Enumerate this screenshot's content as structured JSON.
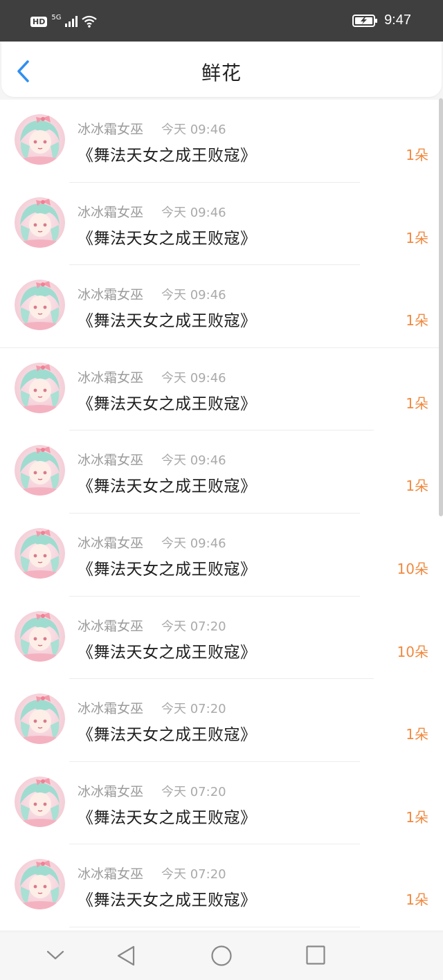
{
  "status_bar": {
    "hd": "HD",
    "network": "5G",
    "time": "9:47"
  },
  "header": {
    "title": "鲜花",
    "back_icon": "chevron-left-icon"
  },
  "colors": {
    "accent_blue": "#2f8ff0",
    "amount_orange": "#f0893f"
  },
  "items": [
    {
      "name": "冰冰霜女巫",
      "time": "今天 09:46",
      "work": "《舞法天女之成王败寇》",
      "amount": "1朵"
    },
    {
      "name": "冰冰霜女巫",
      "time": "今天 09:46",
      "work": "《舞法天女之成王败寇》",
      "amount": "1朵"
    },
    {
      "name": "冰冰霜女巫",
      "time": "今天 09:46",
      "work": "《舞法天女之成王败寇》",
      "amount": "1朵"
    },
    {
      "name": "冰冰霜女巫",
      "time": "今天 09:46",
      "work": "《舞法天女之成王败寇》",
      "amount": "1朵"
    },
    {
      "name": "冰冰霜女巫",
      "time": "今天 09:46",
      "work": "《舞法天女之成王败寇》",
      "amount": "1朵"
    },
    {
      "name": "冰冰霜女巫",
      "time": "今天 09:46",
      "work": "《舞法天女之成王败寇》",
      "amount": "10朵"
    },
    {
      "name": "冰冰霜女巫",
      "time": "今天 07:20",
      "work": "《舞法天女之成王败寇》",
      "amount": "10朵"
    },
    {
      "name": "冰冰霜女巫",
      "time": "今天 07:20",
      "work": "《舞法天女之成王败寇》",
      "amount": "1朵"
    },
    {
      "name": "冰冰霜女巫",
      "time": "今天 07:20",
      "work": "《舞法天女之成王败寇》",
      "amount": "1朵"
    },
    {
      "name": "冰冰霜女巫",
      "time": "今天 07:20",
      "work": "《舞法天女之成王败寇》",
      "amount": "1朵"
    }
  ],
  "nav_bar": {
    "icons": [
      "chevron-down-icon",
      "back-triangle-icon",
      "home-circle-icon",
      "recents-square-icon"
    ]
  }
}
